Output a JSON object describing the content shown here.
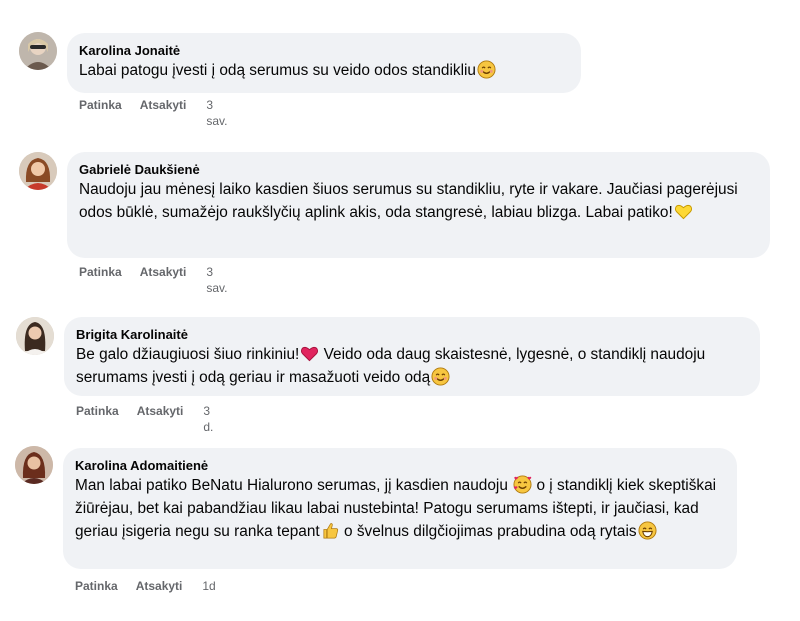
{
  "comments": [
    {
      "author": "Karolina Jonaitė",
      "text": "Labai patogu įvesti į odą serumus su veido odos standikliu",
      "emoji": "smiling-face-icon",
      "like": "Patinka",
      "reply": "Atsakyti",
      "time": "3 sav."
    },
    {
      "author": "Gabrielė Daukšienė",
      "text": "Naudoju jau mėnesį laiko kasdien šiuos serumus su standikliu, ryte ir vakare. Jaučiasi pagerėjusi odos būklė, sumažėjo raukšlyčių aplink akis, oda stangresė, labiau blizga. Labai patiko!",
      "emoji": "yellow-heart-icon",
      "like": "Patinka",
      "reply": "Atsakyti",
      "time": "3 sav."
    },
    {
      "author": "Brigita Karolinaitė",
      "text_a": "Be galo džiaugiuosi šiuo rinkiniu!",
      "text_b": " Veido oda daug skaistesnė, lygesnė, o standiklį naudoju serumams įvesti į odą geriau ir masažuoti veido odą",
      "like": "Patinka",
      "reply": "Atsakyti",
      "time": "3 d."
    },
    {
      "author": "Karolina Adomaitienė",
      "text_a": "Man labai patiko BeNatu Hialurono serumas, jį kasdien naudoju ",
      "text_b": " o į standiklį kiek skeptiškai žiūrėjau, bet kai pabandžiau likau labai nustebinta! Patogu serumams ištepti, ir jaučiasi, kad geriau įsigeria negu su ranka tepant",
      "text_c": " o švelnus dilgčiojimas prabudina odą rytais",
      "like": "Patinka",
      "reply": "Atsakyti",
      "time": "1d"
    }
  ]
}
